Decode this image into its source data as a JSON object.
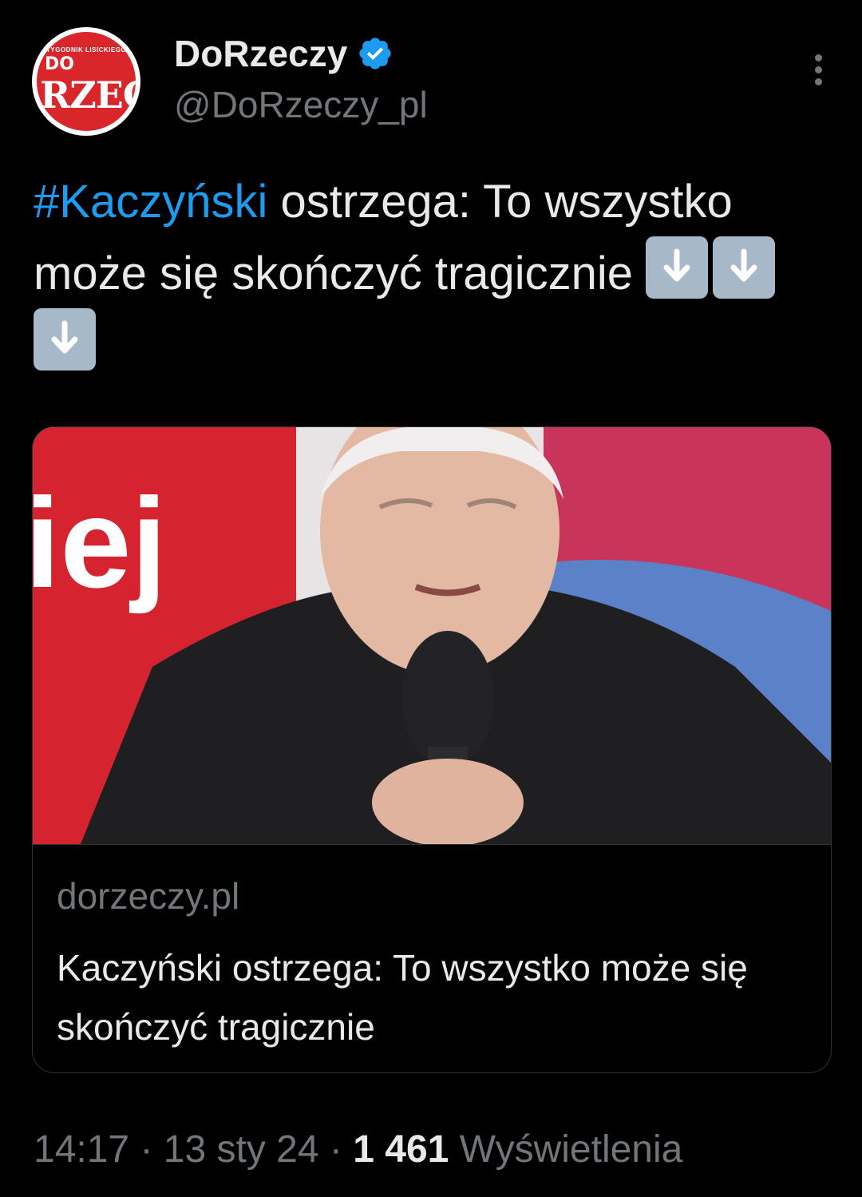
{
  "account": {
    "name": "DoRzeczy",
    "handle": "@DoRzeczy_pl",
    "avatar_text_top": "TYGODNIK LISICKIEGO",
    "avatar_text_mid": "DO",
    "avatar_text_main": "RZEC",
    "verified_color": "#1d9bf0"
  },
  "tweet": {
    "hashtag": "#Kaczyński",
    "text": " ostrzega: To wszystko może się skończyć tragicznie ",
    "emoji_icons": [
      "down-arrow-emoji",
      "down-arrow-emoji",
      "down-arrow-emoji"
    ]
  },
  "card": {
    "domain": "dorzeczy.pl",
    "title": "Kaczyński ostrzega: To wszystko może się skończyć tragicznie",
    "banner_text": "iej"
  },
  "meta": {
    "time": "14:17",
    "sep1": " · ",
    "date": "13 sty 24",
    "sep2": " · ",
    "views_count": "1 461",
    "views_label": " Wyświetlenia"
  },
  "colors": {
    "background": "#000000",
    "text": "#e7e9ea",
    "secondary": "#71767b",
    "link": "#1d9bf0",
    "border": "#2f3336"
  }
}
